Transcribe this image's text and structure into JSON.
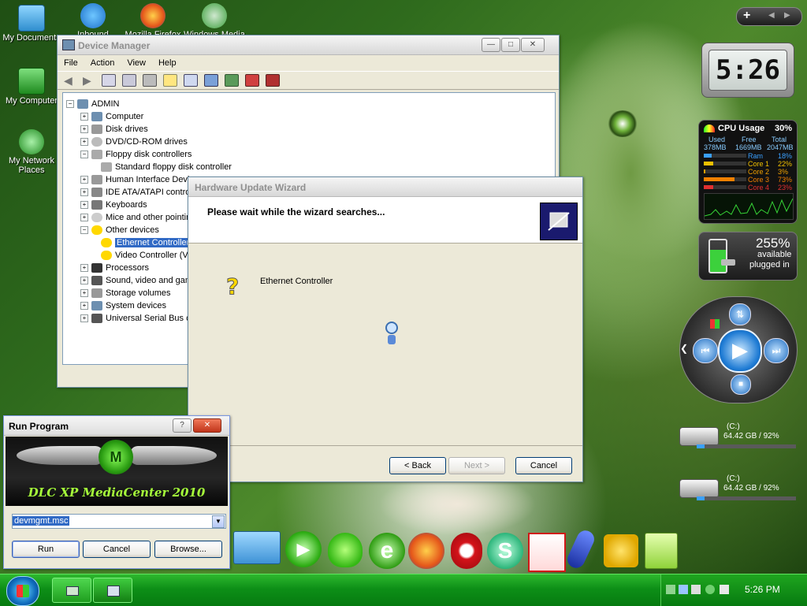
{
  "desktop": {
    "icons": [
      {
        "label": "My Documents"
      },
      {
        "label": "My Computer"
      },
      {
        "label": "My Network Places"
      },
      {
        "label": "Inbound"
      },
      {
        "label": "Mozilla Firefox"
      },
      {
        "label": "Windows Media"
      }
    ]
  },
  "device_manager": {
    "title": "Device Manager",
    "menu": [
      "File",
      "Action",
      "View",
      "Help"
    ],
    "tree": {
      "root": "ADMIN",
      "items": [
        {
          "label": "Computer",
          "expander": "+"
        },
        {
          "label": "Disk drives",
          "expander": "+"
        },
        {
          "label": "DVD/CD-ROM drives",
          "expander": "+"
        },
        {
          "label": "Floppy disk controllers",
          "expander": "−"
        },
        {
          "label": "Standard floppy disk controller",
          "child": true
        },
        {
          "label": "Human Interface Devices",
          "expander": "+"
        },
        {
          "label": "IDE ATA/ATAPI controllers",
          "expander": "+"
        },
        {
          "label": "Keyboards",
          "expander": "+"
        },
        {
          "label": "Mice and other pointing devices",
          "expander": "+"
        },
        {
          "label": "Other devices",
          "expander": "−"
        },
        {
          "label": "Ethernet Controller",
          "child": true,
          "selected": true
        },
        {
          "label": "Video Controller (VGA Compatible)",
          "child": true
        },
        {
          "label": "Processors",
          "expander": "+"
        },
        {
          "label": "Sound, video and game controllers",
          "expander": "+"
        },
        {
          "label": "Storage volumes",
          "expander": "+"
        },
        {
          "label": "System devices",
          "expander": "+"
        },
        {
          "label": "Universal Serial Bus controllers",
          "expander": "+"
        }
      ]
    }
  },
  "wizard": {
    "title": "Hardware Update Wizard",
    "heading": "Please wait while the wizard searches...",
    "device": "Ethernet Controller",
    "back_label": "< Back",
    "next_label": "Next >",
    "cancel_label": "Cancel"
  },
  "run_dialog": {
    "title": "Run Program",
    "help_label": "?",
    "banner_text": "DLC XP MediaCenter 2010",
    "banner_logo": "M",
    "command_value": "devmgmt.msc",
    "run_label": "Run",
    "cancel_label": "Cancel",
    "browse_label": "Browse..."
  },
  "gadgets": {
    "clock_time": "5:26",
    "cpu": {
      "title": "CPU Usage",
      "percent": "30%",
      "used_label": "Used",
      "free_label": "Free",
      "total_label": "Total",
      "used": "378MB",
      "free": "1669MB",
      "total": "2047MB",
      "rows": [
        {
          "name": "Ram",
          "value": "18%",
          "fill": 0.18,
          "color": "#3aa0ff"
        },
        {
          "name": "Core 1",
          "value": "22%",
          "fill": 0.22,
          "color": "#f0c000"
        },
        {
          "name": "Core 2",
          "value": "3%",
          "fill": 0.03,
          "color": "#f0a000"
        },
        {
          "name": "Core 3",
          "value": "73%",
          "fill": 0.73,
          "color": "#f08000"
        },
        {
          "name": "Core 4",
          "value": "23%",
          "fill": 0.23,
          "color": "#e03030"
        }
      ]
    },
    "battery": {
      "percent": "255%",
      "status1": "available",
      "status2": "plugged in"
    },
    "drives": [
      {
        "label": "(C:)",
        "info": "64.42 GB / 92%"
      },
      {
        "label": "(C:)",
        "info": "64.42 GB / 92%"
      }
    ],
    "sidebar_add": "+"
  },
  "taskbar": {
    "clock": "5:26 PM"
  },
  "colors": {
    "taskbar": "#0d8f17",
    "selection": "#316ac5",
    "wizard_header_icon": "#1a1a6e"
  }
}
